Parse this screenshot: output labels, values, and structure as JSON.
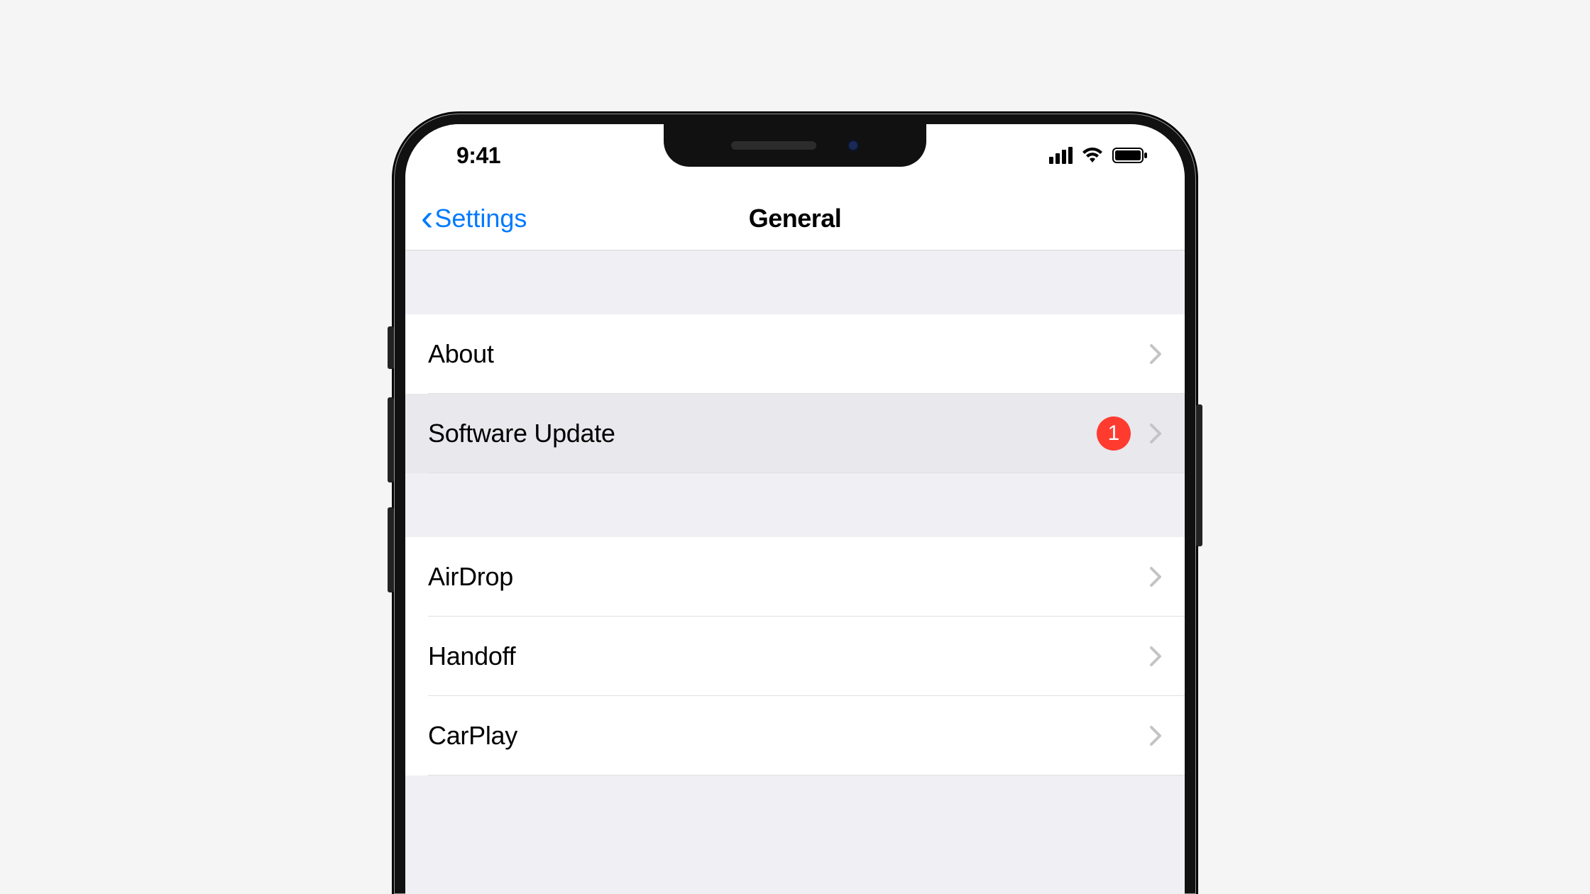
{
  "status": {
    "time": "9:41"
  },
  "nav": {
    "back_label": "Settings",
    "title": "General"
  },
  "groups": [
    {
      "rows": [
        {
          "label": "About",
          "badge": null,
          "highlighted": false
        },
        {
          "label": "Software Update",
          "badge": "1",
          "highlighted": true
        }
      ]
    },
    {
      "rows": [
        {
          "label": "AirDrop",
          "badge": null,
          "highlighted": false
        },
        {
          "label": "Handoff",
          "badge": null,
          "highlighted": false
        },
        {
          "label": "CarPlay",
          "badge": null,
          "highlighted": false
        }
      ]
    }
  ],
  "colors": {
    "accent": "#007aff",
    "badge": "#ff3b30",
    "disclosure": "#c4c4c7"
  }
}
